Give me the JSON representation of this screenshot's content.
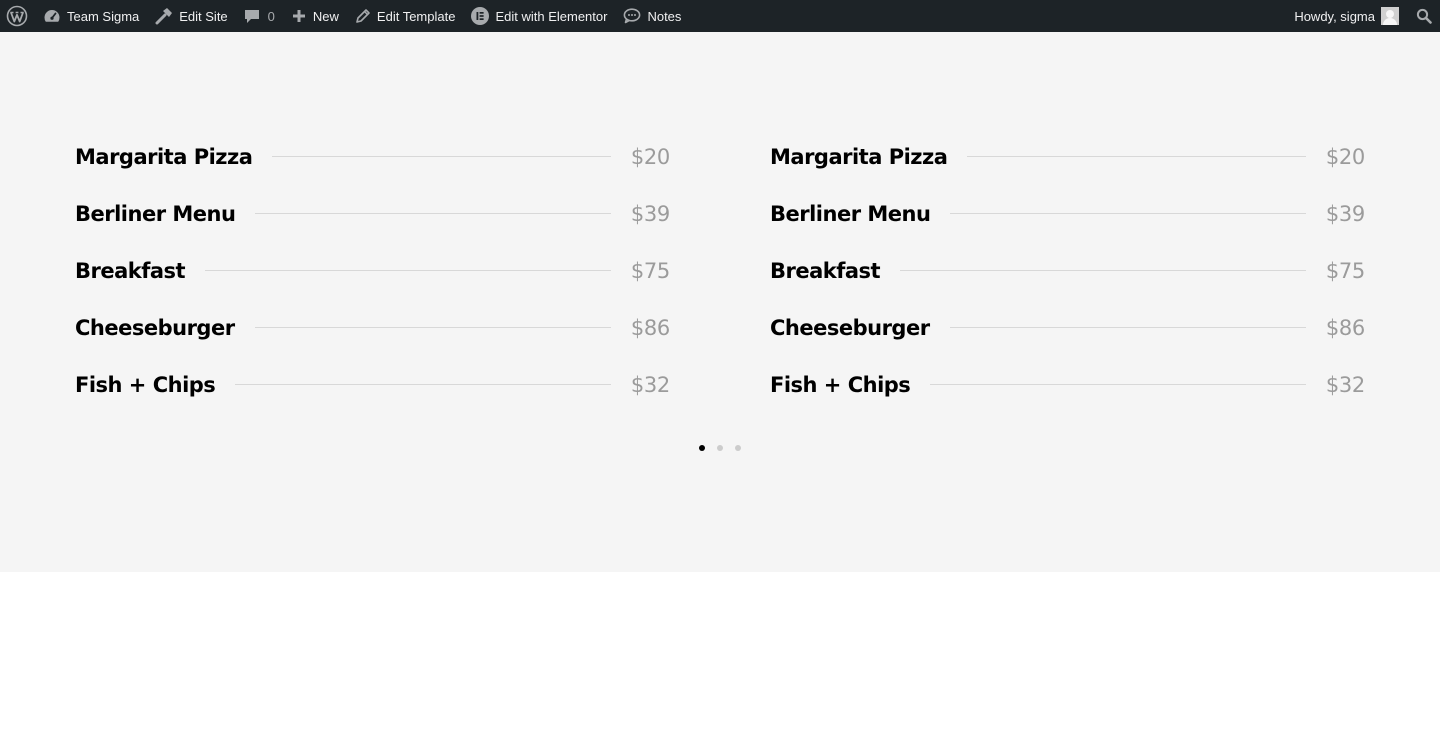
{
  "adminbar": {
    "site_name": "Team Sigma",
    "edit_site": "Edit Site",
    "comments_count": "0",
    "new_label": "New",
    "edit_template": "Edit Template",
    "edit_elementor": "Edit with Elementor",
    "notes": "Notes",
    "howdy": "Howdy, sigma",
    "icons": [
      "wordpress-logo-icon",
      "dashboard-icon",
      "hammer-icon",
      "comment-icon",
      "plus-icon",
      "pencil-icon",
      "elementor-icon",
      "chat-bubble-icon",
      "search-icon"
    ]
  },
  "menu": {
    "left": [
      {
        "title": "Margarita Pizza",
        "price": "$20"
      },
      {
        "title": "Berliner Menu",
        "price": "$39"
      },
      {
        "title": "Breakfast",
        "price": "$75"
      },
      {
        "title": "Cheeseburger",
        "price": "$86"
      },
      {
        "title": "Fish + Chips",
        "price": "$32"
      }
    ],
    "right": [
      {
        "title": "Margarita Pizza",
        "price": "$20"
      },
      {
        "title": "Berliner Menu",
        "price": "$39"
      },
      {
        "title": "Breakfast",
        "price": "$75"
      },
      {
        "title": "Cheeseburger",
        "price": "$86"
      },
      {
        "title": "Fish + Chips",
        "price": "$32"
      }
    ]
  },
  "pagination": {
    "total": 3,
    "active": 1
  },
  "colors": {
    "adminbar_bg": "#1d2327",
    "section_bg": "#f5f5f5",
    "title": "#000000",
    "price": "#9b9b9b",
    "divider": "#d8d8d8"
  }
}
